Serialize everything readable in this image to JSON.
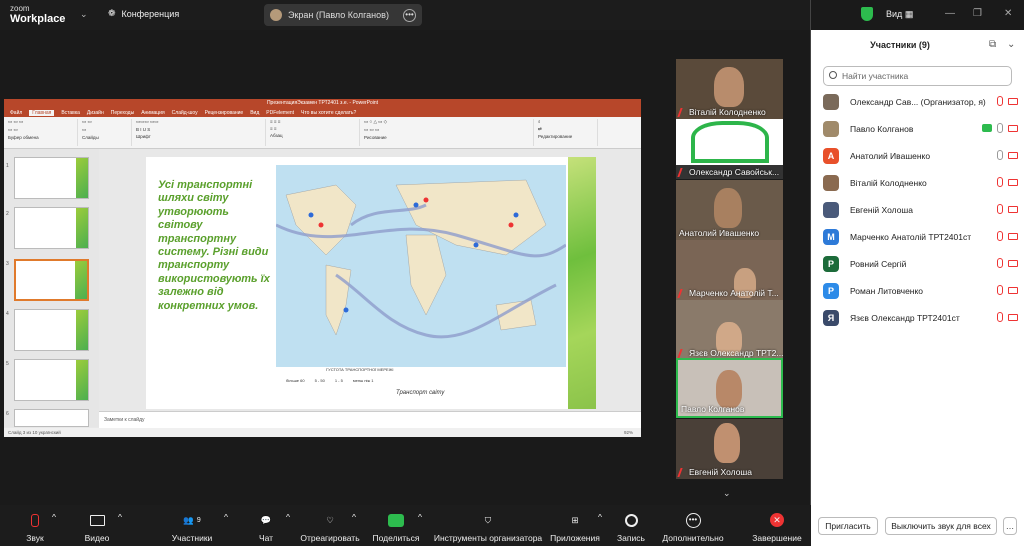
{
  "app": {
    "logo_top": "zoom",
    "logo_bottom": "Workplace",
    "conference": "Конференция"
  },
  "screen_share": {
    "label": "Экран (Павло Колганов)"
  },
  "view": {
    "label": "Вид"
  },
  "ppt": {
    "title": "ПрезентацияЭкзамен ТРТ2401 з.е. - PowerPoint",
    "tabs": [
      "Файл",
      "Главная",
      "Вставка",
      "Дизайн",
      "Переходы",
      "Анимация",
      "Слайд-шоу",
      "Рецензирование",
      "Вид",
      "PDFelement",
      "Что вы хотите сделать?"
    ],
    "ribbon_groups": [
      "Буфер обмена",
      "Слайды",
      "Шрифт",
      "Абзац",
      "Рисование",
      "Редактирование"
    ],
    "slide_text": "Усі транспортні шляхи світу утворюють світову транспортну систему. Різні види транспорту використовують їх залежно від конкретних умов.",
    "map_caption": "Транспорт світу",
    "legend_title": "ГУСТОТА ТРАНСПОРТНОЇ МЕРЕЖІ",
    "legend_items": [
      "більше 60",
      "5 - 50",
      "1 - 5",
      "менш ніж 1"
    ],
    "notes": "Заметки к слайду",
    "status": "Слайд 3 из 10    українский",
    "zoom": "92%"
  },
  "video_tiles": [
    {
      "name": "Віталій Колодненко",
      "muted": true
    },
    {
      "name": "Олександр Савойськ...",
      "muted": true
    },
    {
      "name": "Анатолий Ивашенко",
      "muted": false
    },
    {
      "name": "Марченко Анатолій Т...",
      "muted": true
    },
    {
      "name": "Язєв Олександр ТРТ2...",
      "muted": true
    },
    {
      "name": "Павло Колганов",
      "muted": false
    },
    {
      "name": "Евгеній Холоша",
      "muted": true
    }
  ],
  "participants": {
    "title": "Участники (9)",
    "search_placeholder": "Найти участника",
    "list": [
      {
        "name": "Олександр Сав...  (Организатор, я)",
        "initial": "",
        "color": "#7a6a5a",
        "mic": "off",
        "cam": "off",
        "share": false
      },
      {
        "name": "Павло Колганов",
        "initial": "",
        "color": "#a08a6a",
        "mic": "on",
        "cam": "off",
        "share": true
      },
      {
        "name": "Анатолий Ивашенко",
        "initial": "А",
        "color": "#e8502a",
        "mic": "on",
        "cam": "off",
        "share": false
      },
      {
        "name": "Віталій Колодненко",
        "initial": "",
        "color": "#8a6a50",
        "mic": "off",
        "cam": "off",
        "share": false
      },
      {
        "name": "Евгеній Холоша",
        "initial": "",
        "color": "#4a5a7a",
        "mic": "off",
        "cam": "off",
        "share": false
      },
      {
        "name": "Марченко Анатолій ТРТ2401ст",
        "initial": "М",
        "color": "#2d7ad8",
        "mic": "off",
        "cam": "off",
        "share": false
      },
      {
        "name": "Ровний Сергій",
        "initial": "Р",
        "color": "#1c6b3a",
        "mic": "off",
        "cam": "off",
        "share": false
      },
      {
        "name": "Роман Литовченко",
        "initial": "Р",
        "color": "#2d8be8",
        "mic": "off",
        "cam": "off",
        "share": false
      },
      {
        "name": "Язєв Олександр ТРТ2401ст",
        "initial": "Я",
        "color": "#3a4a6a",
        "mic": "off",
        "cam": "off",
        "share": false
      }
    ],
    "invite": "Пригласить",
    "mute_all": "Выключить звук для всех"
  },
  "toolbar": {
    "audio": "Звук",
    "video": "Видео",
    "participants": "Участники",
    "participants_count": "9",
    "chat": "Чат",
    "react": "Отреагировать",
    "share": "Поделиться",
    "host_tools": "Инструменты организатора",
    "apps": "Приложения",
    "record": "Запись",
    "more": "Дополнительно",
    "end": "Завершение"
  }
}
